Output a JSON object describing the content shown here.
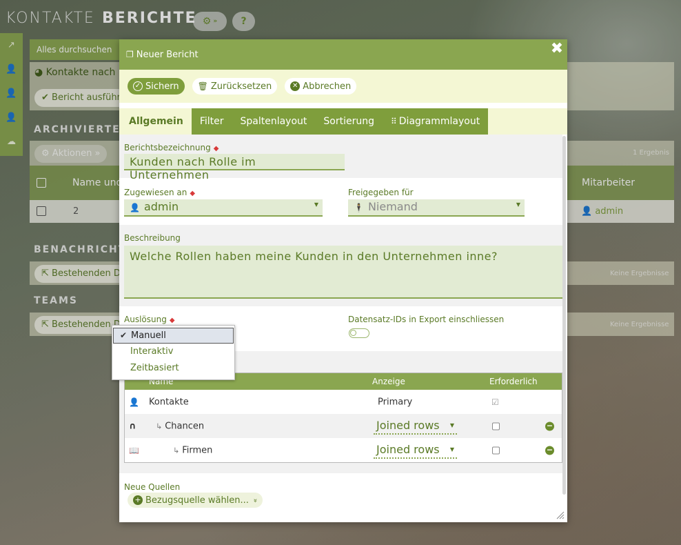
{
  "app": {
    "nav_module": "KONTAKTE",
    "nav_page": "BERICHTE"
  },
  "background": {
    "search_label": "Alles durchsuchen",
    "report_title": "Kontakte nach",
    "run_button": "Bericht ausführ",
    "archived_header": "ARCHIVIERTE",
    "actions_button": "Aktionen",
    "results_count": "1 Ergebnis",
    "grid_col_name": "Name und",
    "grid_col_staff": "Mitarbeiter",
    "grid_row_num": "2",
    "grid_row_staff": "admin",
    "notifications_header": "BENACHRICHT",
    "existing_1": "Bestehenden Da",
    "no_results_1": "Keine Ergebnisse",
    "teams_header": "TEAMS",
    "existing_2": "Bestehenden D",
    "no_results_2": "Keine Ergebnisse"
  },
  "modal": {
    "title": "Neuer Bericht",
    "close_glyph": "✖",
    "actions": {
      "save": "Sichern",
      "reset": "Zurücksetzen",
      "cancel": "Abbrechen"
    },
    "tabs": [
      {
        "label": "Allgemein"
      },
      {
        "label": "Filter"
      },
      {
        "label": "Spaltenlayout"
      },
      {
        "label": "Sortierung"
      },
      {
        "label": "Diagrammlayout"
      }
    ],
    "fields": {
      "report_name_label": "Berichtsbezeichnung",
      "report_name_value": "Kunden nach Rolle im Unternehmen",
      "assigned_label": "Zugewiesen an",
      "assigned_value": "admin",
      "shared_label": "Freigegeben für",
      "shared_value": "Niemand",
      "description_label": "Beschreibung",
      "description_value": "Welche Rollen haben meine Kunden in den Unternehmen inne?",
      "trigger_label": "Auslösung",
      "include_ids_label": "Datensatz-IDs in Export einschliessen"
    },
    "trigger_options": [
      {
        "label": "Manuell",
        "selected": true
      },
      {
        "label": "Interaktiv",
        "selected": false
      },
      {
        "label": "Zeitbasiert",
        "selected": false
      }
    ],
    "sources": {
      "headers": {
        "name": "Name",
        "display": "Anzeige",
        "required": "Erforderlich"
      },
      "rows": [
        {
          "icon": "person-icon",
          "name": "Kontakte",
          "display": "Primary"
        },
        {
          "icon": "magnet-icon",
          "name": "Chancen",
          "display": "Joined rows"
        },
        {
          "icon": "book-icon",
          "name": "Firmen",
          "display": "Joined rows"
        }
      ]
    },
    "new_sources_label": "Neue Quellen",
    "choose_source_button": "Bezugsquelle wählen..."
  }
}
